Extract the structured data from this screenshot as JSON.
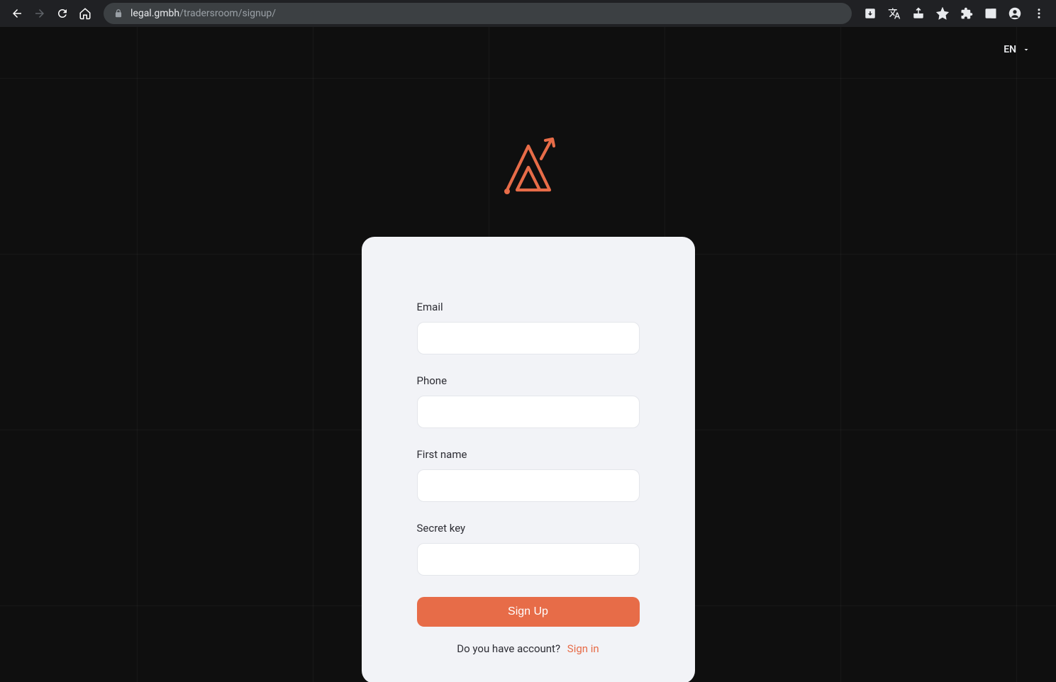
{
  "browser": {
    "url_host": "legal.gmbh",
    "url_path": "/tradersroom/signup/"
  },
  "header": {
    "language": "EN"
  },
  "form": {
    "email_label": "Email",
    "phone_label": "Phone",
    "firstname_label": "First name",
    "secretkey_label": "Secret key",
    "submit_label": "Sign Up",
    "have_account_text": "Do you have account?",
    "signin_label": "Sign in"
  },
  "colors": {
    "accent": "#e76c48"
  }
}
